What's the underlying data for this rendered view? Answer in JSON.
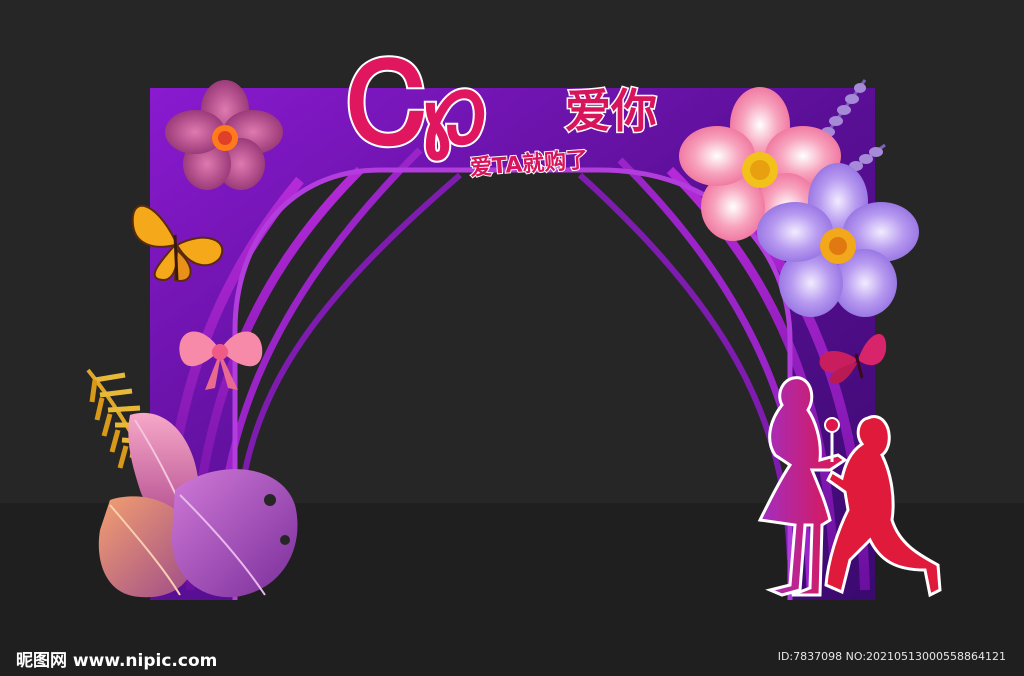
{
  "scene": {
    "title_main": "Ꮯ℘",
    "title_love": "爱你",
    "title_sub": "爱TA就购了",
    "colors": {
      "background": "#262626",
      "floor": "#1f1f1f",
      "arch_purple": "#7a13b8",
      "title_pink": "#e0165f"
    }
  },
  "watermark": {
    "site": "昵图网 www.nipic.com",
    "id_text": "ID:7837098 NO:20210513000558864121"
  },
  "icons": [
    "flower-icon",
    "butterfly-icon",
    "bow-icon",
    "leaf-icon",
    "lavender-icon",
    "couple-silhouette-icon"
  ]
}
